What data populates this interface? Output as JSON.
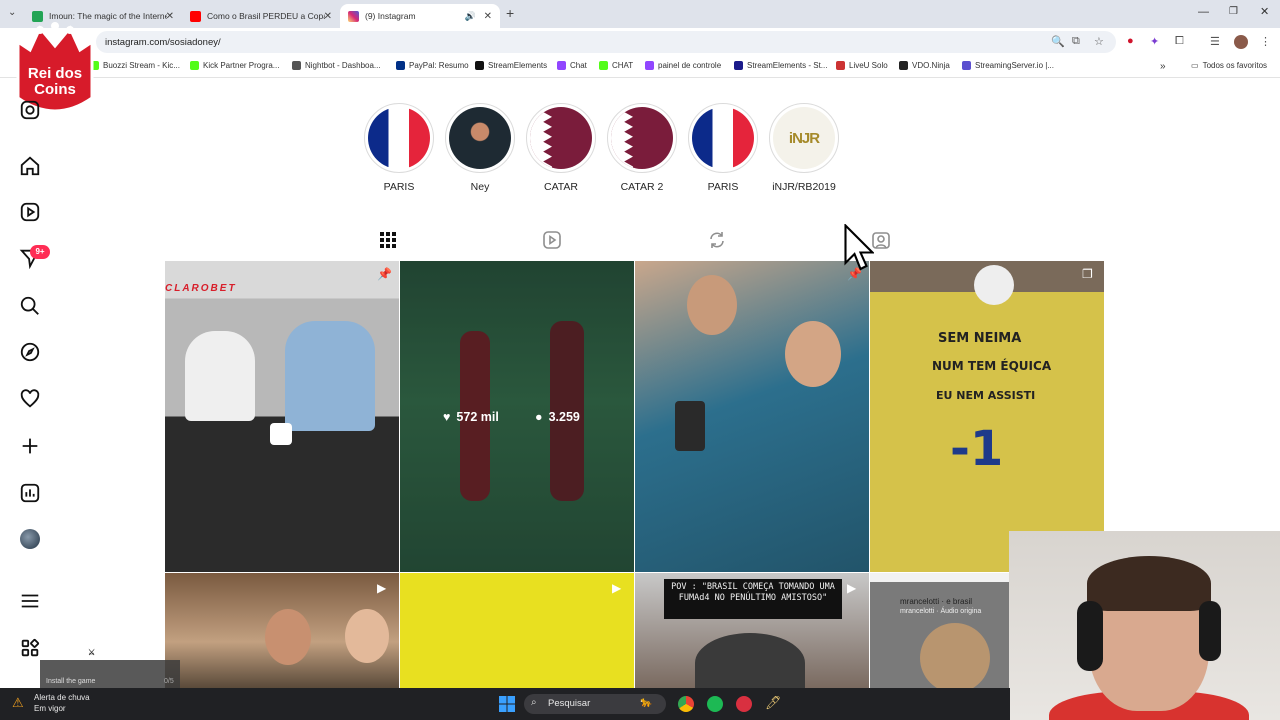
{
  "browser": {
    "tabs": [
      {
        "title": "Imoun: The magic of the Interne",
        "color": "#23a455"
      },
      {
        "title": "Como o Brasil PERDEU a Copa",
        "color": "#ff0000"
      },
      {
        "title": "(9) Instagram",
        "color": "#d62976"
      }
    ],
    "url": "instagram.com/sosiadoney/",
    "bookmarks": [
      {
        "label": "Buozzi Stream - Kic...",
        "color": "#53fc18"
      },
      {
        "label": "Kick Partner Progra...",
        "color": "#53fc18"
      },
      {
        "label": "Nightbot - Dashboa...",
        "color": "#555555"
      },
      {
        "label": "PayPal: Resumo",
        "color": "#003087"
      },
      {
        "label": "StreamElements",
        "color": "#111111"
      },
      {
        "label": "Chat",
        "color": "#9146ff"
      },
      {
        "label": "CHAT",
        "color": "#53fc18"
      },
      {
        "label": "painel de controle",
        "color": "#9146ff"
      },
      {
        "label": "StreamElements - St...",
        "color": "#1a1a8a"
      },
      {
        "label": "LiveU Solo",
        "color": "#cc3333"
      },
      {
        "label": "VDO.Ninja",
        "color": "#222222"
      },
      {
        "label": "StreamingServer.io |...",
        "color": "#5b4fcf"
      }
    ],
    "all_bookmarks": "Todos os favoritos"
  },
  "logo": {
    "line1": "Rei dos",
    "line2": "Coins"
  },
  "sidebar": {
    "notif_count": "9+"
  },
  "highlights": [
    {
      "label": "PARIS",
      "kind": "flag-fr"
    },
    {
      "label": "Ney",
      "kind": "ney"
    },
    {
      "label": "CATAR",
      "kind": "flag-qa"
    },
    {
      "label": "CATAR 2",
      "kind": "flag-qa"
    },
    {
      "label": "PARIS",
      "kind": "flag-fr"
    },
    {
      "label": "iNJR/RB2019",
      "kind": "injr"
    }
  ],
  "grid": {
    "hover_likes": "572 mil",
    "hover_comments": "3.259",
    "tile1_brand": "CLAROBET",
    "shirt_lines": [
      "SEM NEIMA",
      "NUM TEM ÉQUICA",
      "EU NEM ASSISTI"
    ],
    "shirt_number": "-1",
    "pov_text": "POV : \"BRASIL COMEÇA TOMANDO UMA FUMAd4 NO PENÚLTIMO AMISTOSO\"",
    "audio_user": "mrancelotti",
    "audio_user_tag": "e brasil",
    "audio_label": "mrancelotti · Áudio origina"
  },
  "overlay": {
    "install_text": "Install the game",
    "install_count": "0/5"
  },
  "taskbar": {
    "weather_title": "Alerta de chuva",
    "weather_sub": "Em vigor",
    "search_placeholder": "Pesquisar"
  }
}
